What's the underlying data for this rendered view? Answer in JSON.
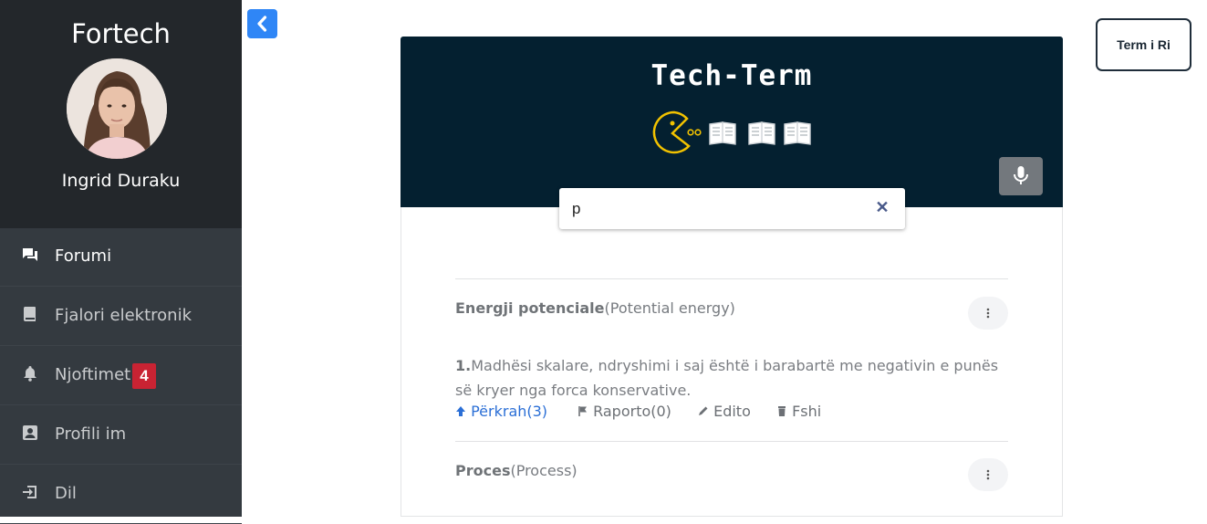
{
  "sidebar": {
    "brand": "Fortech",
    "user_name": "Ingrid Duraku",
    "items": [
      {
        "label": "Forumi",
        "icon": "forum-icon",
        "active": true
      },
      {
        "label": "Fjalori elektronik",
        "icon": "book-icon"
      },
      {
        "label": "Njoftimet",
        "icon": "bell-icon",
        "badge": "4"
      },
      {
        "label": "Profili im",
        "icon": "profile-icon"
      },
      {
        "label": "Dil",
        "icon": "logout-icon"
      }
    ]
  },
  "header": {
    "back_icon": "chevron-left-icon",
    "new_term_label": "Term i Ri"
  },
  "hero": {
    "title": "Tech-Term",
    "icons": [
      "pacman-icon",
      "book-icon",
      "book-icon",
      "book-icon"
    ],
    "mic_icon": "microphone-icon"
  },
  "search": {
    "value": "p",
    "clear_icon": "close-icon"
  },
  "entries": [
    {
      "term": "Energji potenciale",
      "translation": "(Potential energy)",
      "definition_number": "1.",
      "definition": "Madhësi skalare, ndryshimi i saj është i barabartë me negativin e punës së kryer nga forca konservative.",
      "actions": {
        "support": "Përkrah(3)",
        "report": "Raporto(0)",
        "edit": "Edito",
        "delete": "Fshi"
      }
    },
    {
      "term": "Proces",
      "translation": "(Process)"
    }
  ],
  "colors": {
    "sidebar": "#343a40",
    "sidebar_header": "#23272b",
    "hero": "#042030",
    "accent": "#2f86f6",
    "badge": "#c82333",
    "pacman": "#f2c200"
  }
}
